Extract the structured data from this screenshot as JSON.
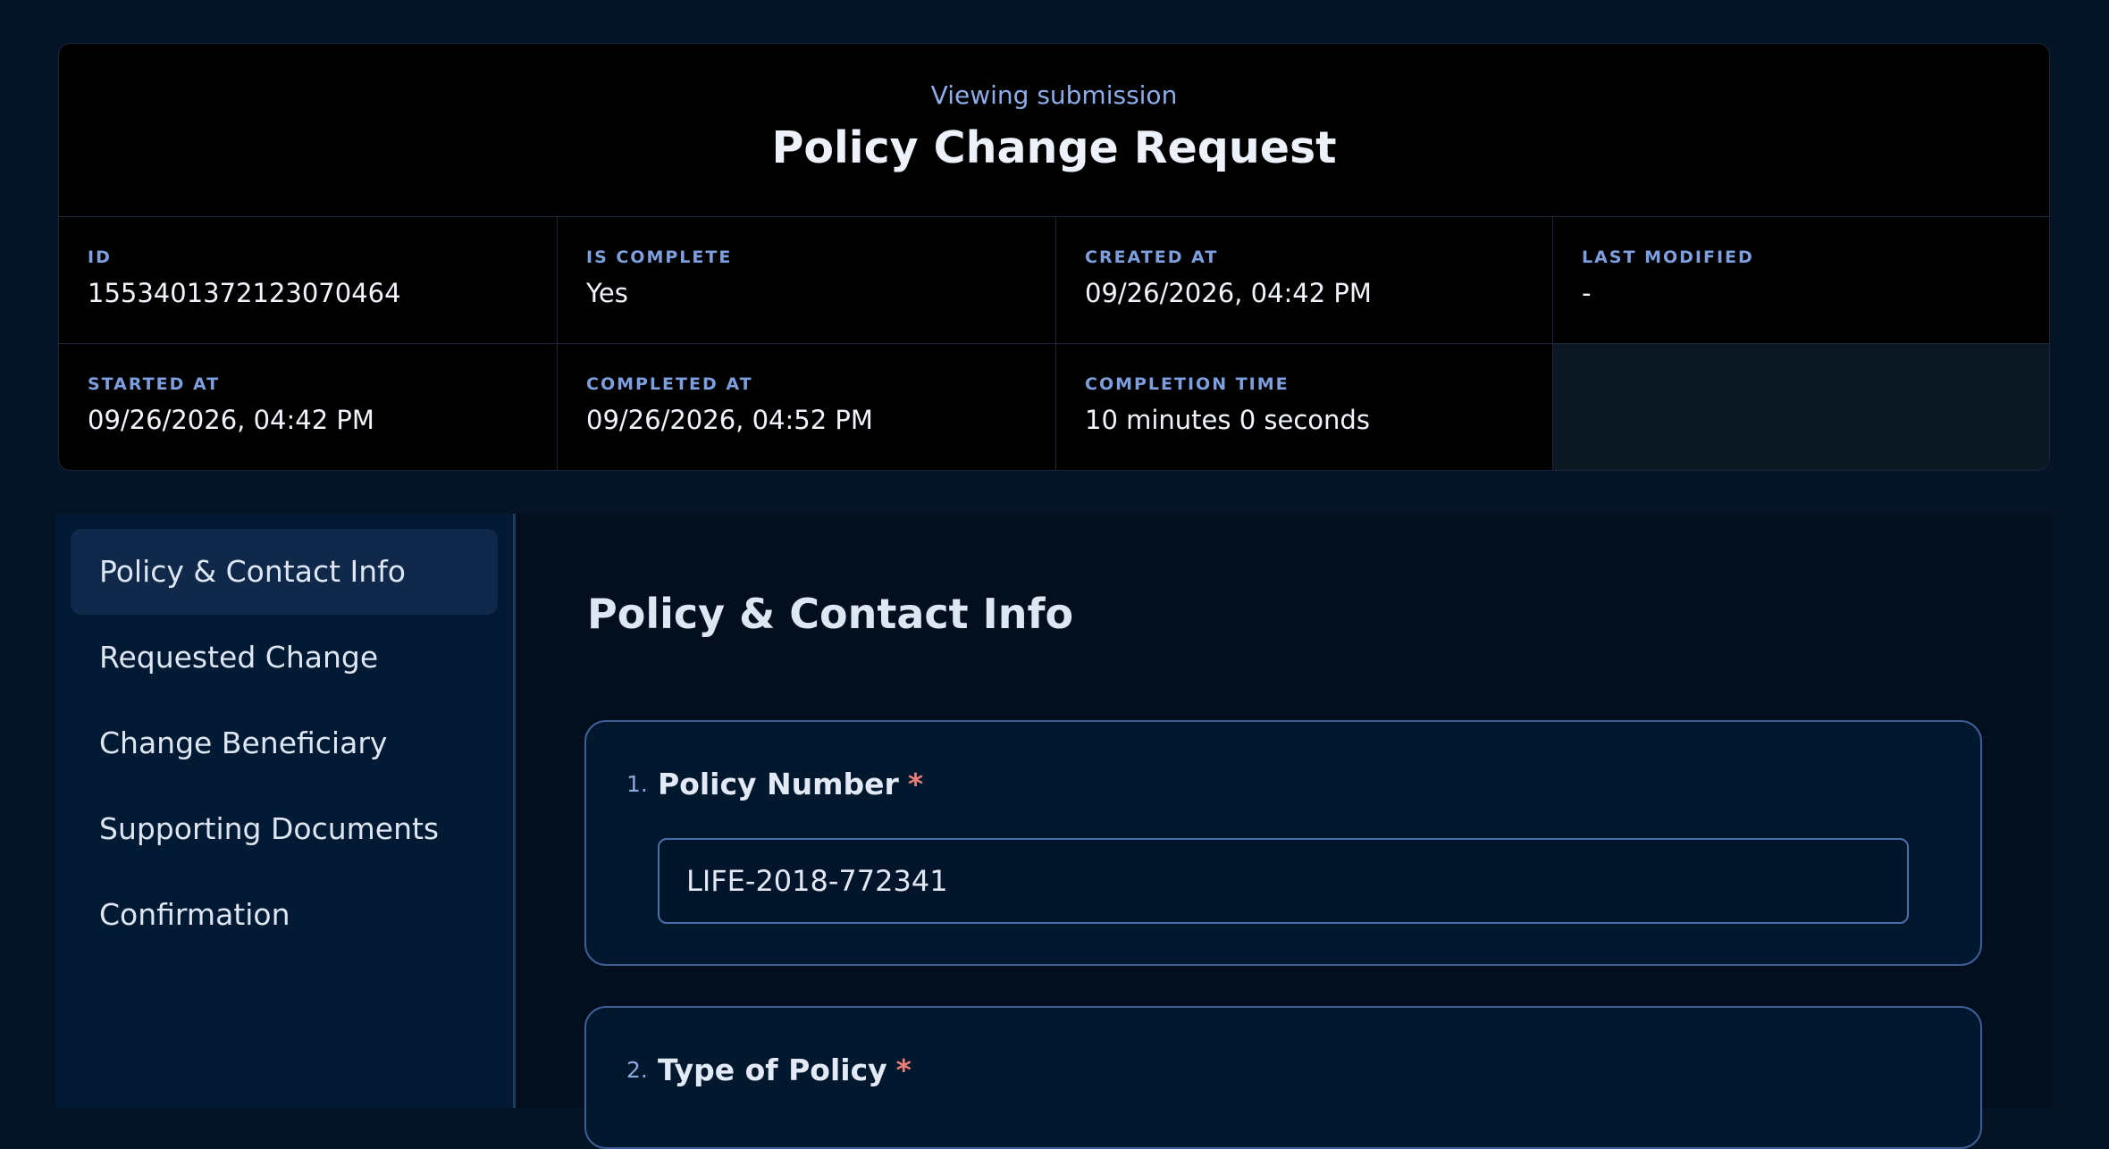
{
  "header": {
    "subtitle": "Viewing submission",
    "title": "Policy Change Request"
  },
  "meta": [
    {
      "label": "ID",
      "value": "1553401372123070464"
    },
    {
      "label": "IS COMPLETE",
      "value": "Yes"
    },
    {
      "label": "CREATED AT",
      "value": "09/26/2026, 04:42 PM"
    },
    {
      "label": "LAST MODIFIED",
      "value": "-"
    },
    {
      "label": "STARTED AT",
      "value": "09/26/2026, 04:42 PM"
    },
    {
      "label": "COMPLETED AT",
      "value": "09/26/2026, 04:52 PM"
    },
    {
      "label": "COMPLETION TIME",
      "value": "10 minutes 0 seconds"
    }
  ],
  "sidebar": {
    "items": [
      {
        "label": "Policy & Contact Info",
        "active": true
      },
      {
        "label": "Requested Change",
        "active": false
      },
      {
        "label": "Change Beneficiary",
        "active": false
      },
      {
        "label": "Supporting Documents",
        "active": false
      },
      {
        "label": "Confirmation",
        "active": false
      }
    ]
  },
  "section": {
    "title": "Policy & Contact Info",
    "questions": [
      {
        "number": "1.",
        "label": "Policy Number",
        "required_mark": "*",
        "value": "LIFE-2018-772341"
      },
      {
        "number": "2.",
        "label": "Type of Policy",
        "required_mark": "*"
      }
    ]
  },
  "colors": {
    "background": "#041426",
    "accent": "#7d9fe0",
    "required": "#ea7d76",
    "card_border": "#3d5f95"
  }
}
